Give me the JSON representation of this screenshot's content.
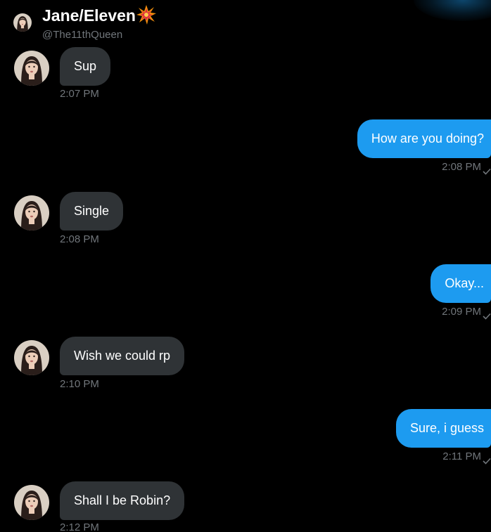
{
  "header": {
    "name": "Jane/Eleven",
    "handle": "@The11thQueen",
    "emoji_icon": "collision-burst-icon"
  },
  "colors": {
    "background": "#000000",
    "incoming_bubble": "#2f3336",
    "outgoing_bubble": "#1d9bf0",
    "timestamp": "#71767b"
  },
  "messages": [
    {
      "direction": "incoming",
      "text": "Sup",
      "time": "2:07 PM"
    },
    {
      "direction": "outgoing",
      "text": "How are you doing?",
      "time": "2:08 PM"
    },
    {
      "direction": "incoming",
      "text": "Single",
      "time": "2:08 PM"
    },
    {
      "direction": "outgoing",
      "text": "Okay...",
      "time": "2:09 PM"
    },
    {
      "direction": "incoming",
      "text": "Wish we could rp",
      "time": "2:10 PM"
    },
    {
      "direction": "outgoing",
      "text": "Sure, i guess",
      "time": "2:11 PM"
    },
    {
      "direction": "incoming",
      "text": "Shall I be Robin?",
      "time": "2:12 PM"
    }
  ]
}
